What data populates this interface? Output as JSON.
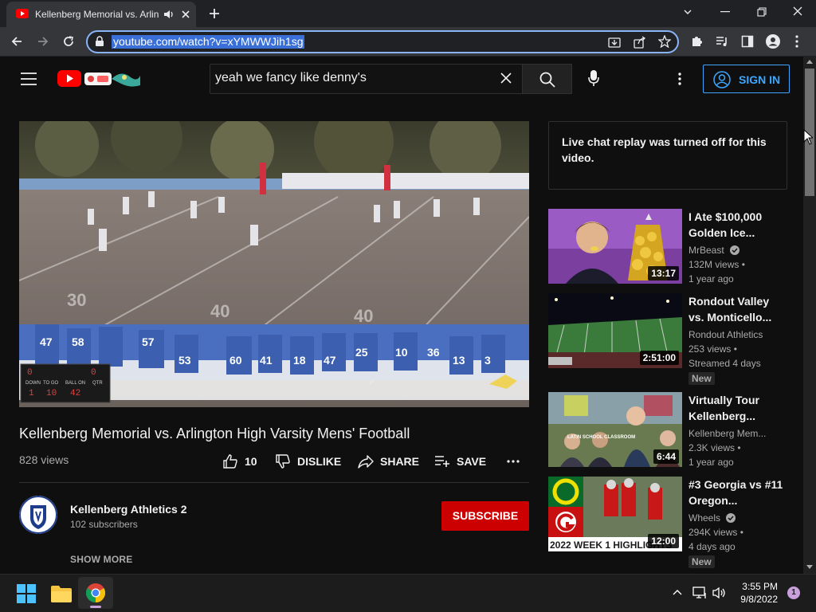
{
  "browser": {
    "tab_title": "Kellenberg Memorial vs. Arlin",
    "url": "youtube.com/watch?v=xYMWWJih1sg",
    "icons": [
      "youtube-favicon",
      "speaker-icon",
      "close-icon",
      "new-tab-icon",
      "back-icon",
      "forward-icon",
      "reload-icon",
      "lock-icon",
      "install-icon",
      "share-icon",
      "star-icon",
      "extensions-icon",
      "media-icon",
      "sidepanel-icon",
      "profile-icon",
      "menu-icon"
    ]
  },
  "masthead": {
    "search_query": "yeah we fancy like denny's",
    "signin_label": "SIGN IN"
  },
  "video": {
    "title": "Kellenberg Memorial vs. Arlington High Varsity Mens' Football",
    "views": "828 views",
    "likes": "10",
    "dislike_label": "DISLIKE",
    "share_label": "SHARE",
    "save_label": "SAVE",
    "scoreboard": {
      "down_label": "DOWN",
      "to_go_label": "TO GO",
      "ball_on_label": "BALL ON",
      "qtr_label": "QTR",
      "down": "1",
      "to_go": "10",
      "ball_on": "42",
      "home": "0",
      "away": "0"
    },
    "field_numbers": [
      "30",
      "40",
      "40"
    ]
  },
  "channel": {
    "name": "Kellenberg Athletics 2",
    "subscribers": "102 subscribers",
    "subscribe_label": "SUBSCRIBE",
    "show_more_label": "SHOW MORE"
  },
  "sidebar": {
    "chat_message": "Live chat replay was turned off for this video.",
    "recommendations": [
      {
        "title": "I Ate $100,000 Golden Ice...",
        "channel": "MrBeast",
        "verified": true,
        "views": "132M views",
        "age": "1 year ago",
        "duration": "13:17",
        "badge": ""
      },
      {
        "title": "Rondout Valley vs. Monticello...",
        "channel": "Rondout Athletics",
        "verified": false,
        "views": "253 views",
        "age": "Streamed 4 days",
        "duration": "2:51:00",
        "badge": "New"
      },
      {
        "title": "Virtually Tour Kellenberg...",
        "channel": "Kellenberg Mem...",
        "verified": false,
        "views": "2.3K views",
        "age": "1 year ago",
        "duration": "6:44",
        "badge": "",
        "thumb_caption": "LATIN SCHOOL CLASSROOM"
      },
      {
        "title": "#3 Georgia vs #11 Oregon...",
        "channel": "Wheels",
        "verified": true,
        "views": "294K views",
        "age": "4 days ago",
        "duration": "12:00",
        "badge": "New",
        "thumb_caption": "2022 WEEK 1 HIGHLIGHTS"
      }
    ]
  },
  "taskbar": {
    "time": "3:55 PM",
    "date": "9/8/2022",
    "notification_count": "1"
  },
  "colors": {
    "accent": "#3ea6ff",
    "subscribe": "#cc0000",
    "youtube_red": "#ff0000"
  }
}
